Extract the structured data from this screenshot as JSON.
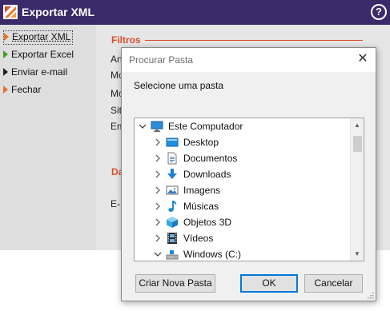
{
  "app": {
    "title": "Exportar XML",
    "help_glyph": "?",
    "logo_icon": "app-logo-icon",
    "colors": {
      "titlebar": "#3b2a6a",
      "accent": "#d9502b"
    }
  },
  "sidebar": {
    "items": [
      {
        "label": "Exportar XML",
        "icon": "orange-arrow-icon",
        "active": true
      },
      {
        "label": "Exportar Excel",
        "icon": "green-arrow-icon",
        "active": false
      },
      {
        "label": "Enviar e-mail",
        "icon": "dark-arrow-icon",
        "active": false
      },
      {
        "label": "Fechar",
        "icon": "orange-arrow-icon",
        "active": false
      }
    ]
  },
  "content": {
    "section_filters": "Filtros",
    "section_partial": "Da",
    "labels": [
      "An",
      "Mo",
      "Mo",
      "Sit",
      "Em",
      "E-"
    ]
  },
  "dialog": {
    "title": "Procurar Pasta",
    "close_glyph": "✕",
    "prompt": "Selecione uma pasta",
    "tree": [
      {
        "label": "Este Computador",
        "icon": "computer-icon",
        "expanded": true,
        "level": 0
      },
      {
        "label": "Desktop",
        "icon": "desktop-folder-icon",
        "expanded": false,
        "level": 1
      },
      {
        "label": "Documentos",
        "icon": "documents-folder-icon",
        "expanded": false,
        "level": 1
      },
      {
        "label": "Downloads",
        "icon": "downloads-folder-icon",
        "expanded": false,
        "level": 1
      },
      {
        "label": "Imagens",
        "icon": "pictures-folder-icon",
        "expanded": false,
        "level": 1
      },
      {
        "label": "Músicas",
        "icon": "music-folder-icon",
        "expanded": false,
        "level": 1
      },
      {
        "label": "Objetos 3D",
        "icon": "3d-objects-folder-icon",
        "expanded": false,
        "level": 1
      },
      {
        "label": "Vídeos",
        "icon": "videos-folder-icon",
        "expanded": false,
        "level": 1
      },
      {
        "label": "Windows (C:)",
        "icon": "drive-icon",
        "expanded": true,
        "level": 1
      }
    ],
    "buttons": {
      "new_folder": "Criar Nova Pasta",
      "ok": "OK",
      "cancel": "Cancelar"
    }
  }
}
